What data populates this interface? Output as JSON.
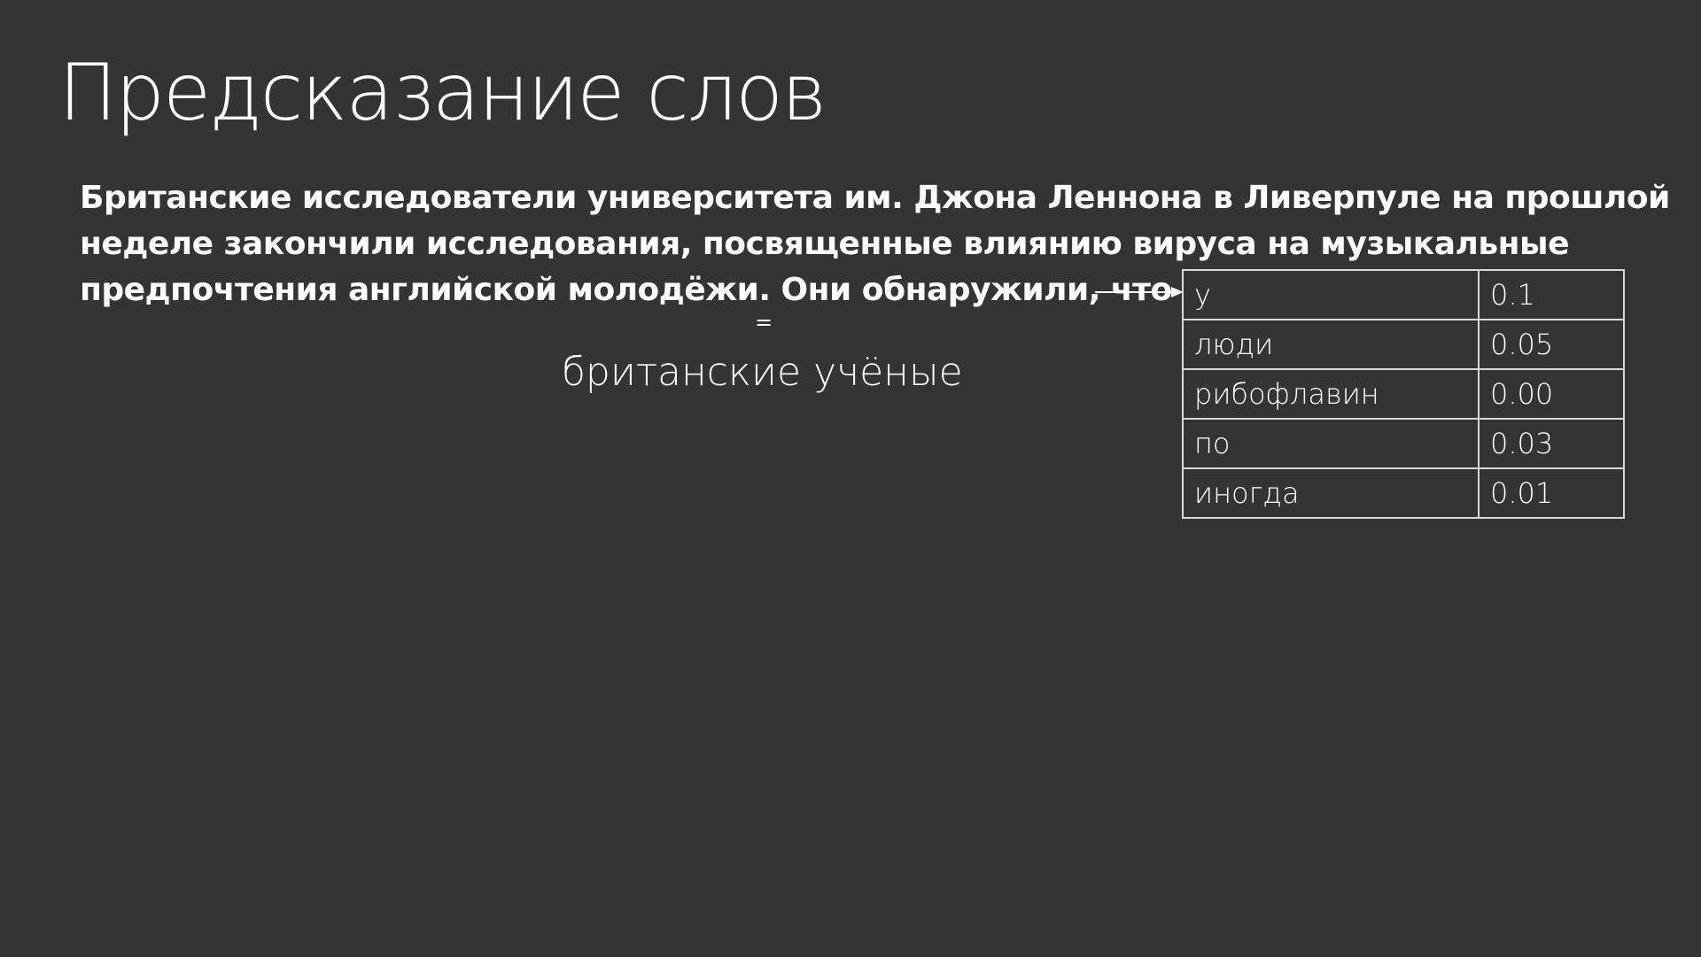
{
  "slide": {
    "title": "Предсказание слов",
    "paragraph_lines": [
      "Британские исследователи университета им. Джона Леннона в Ливерпуле на прошлой",
      "неделе закончили исследования, посвященные влиянию вируса на музыкальные",
      "предпочтения английской молодёжи. Они обнаружили, что"
    ],
    "equals_sign": "=",
    "equivalent_phrase": "британские учёные",
    "arrow_icon": "arrow-right-icon",
    "colors": {
      "background": "#343434",
      "text": "#ffffff",
      "table_border": "#d9d9d9"
    }
  },
  "prediction_table": {
    "rows": [
      {
        "word": "у",
        "prob": "0.1"
      },
      {
        "word": "люди",
        "prob": "0.05"
      },
      {
        "word": "рибофлавин",
        "prob": "0.00"
      },
      {
        "word": "по",
        "prob": "0.03"
      },
      {
        "word": "иногда",
        "prob": "0.01"
      }
    ]
  }
}
